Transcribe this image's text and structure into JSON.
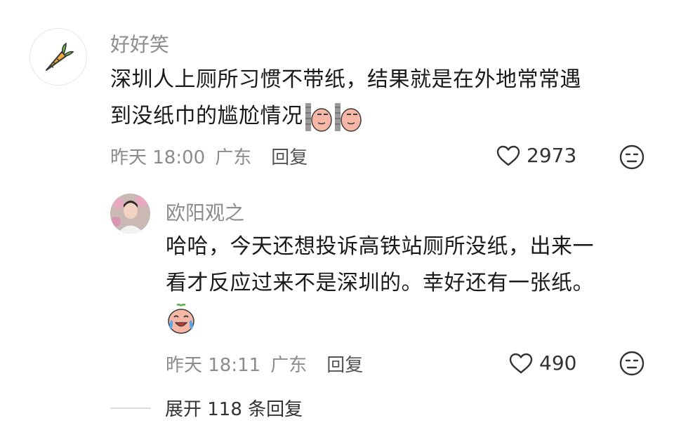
{
  "comment": {
    "username": "好好笑",
    "text_line1": "深圳人上厕所习惯不带纸，结果就是在外地常常遇",
    "text_line2": "到没纸巾的尴尬情况",
    "time": "昨天 18:00",
    "location": "广东",
    "reply_label": "回复",
    "likes": "2973",
    "icons": [
      "carrot-icon",
      "awkward-wall-emoji",
      "heart-outline-icon",
      "meh-face-icon"
    ]
  },
  "reply": {
    "username": "欧阳观之",
    "text_line1": "哈哈，今天还想投诉高铁站厕所没纸，出来一",
    "text_line2": "看才反应过来不是深圳的。幸好还有一张纸。",
    "time": "昨天 18:11",
    "location": "广东",
    "reply_label": "回复",
    "likes": "490",
    "icons": [
      "crying-laughing-emoji",
      "heart-outline-icon",
      "meh-face-icon"
    ]
  },
  "expand": {
    "label": "展开 118 条回复"
  },
  "colors": {
    "muted": "#8c8c8c",
    "text": "#1a1a1a",
    "emoji_pink": "#f6b7a6"
  }
}
